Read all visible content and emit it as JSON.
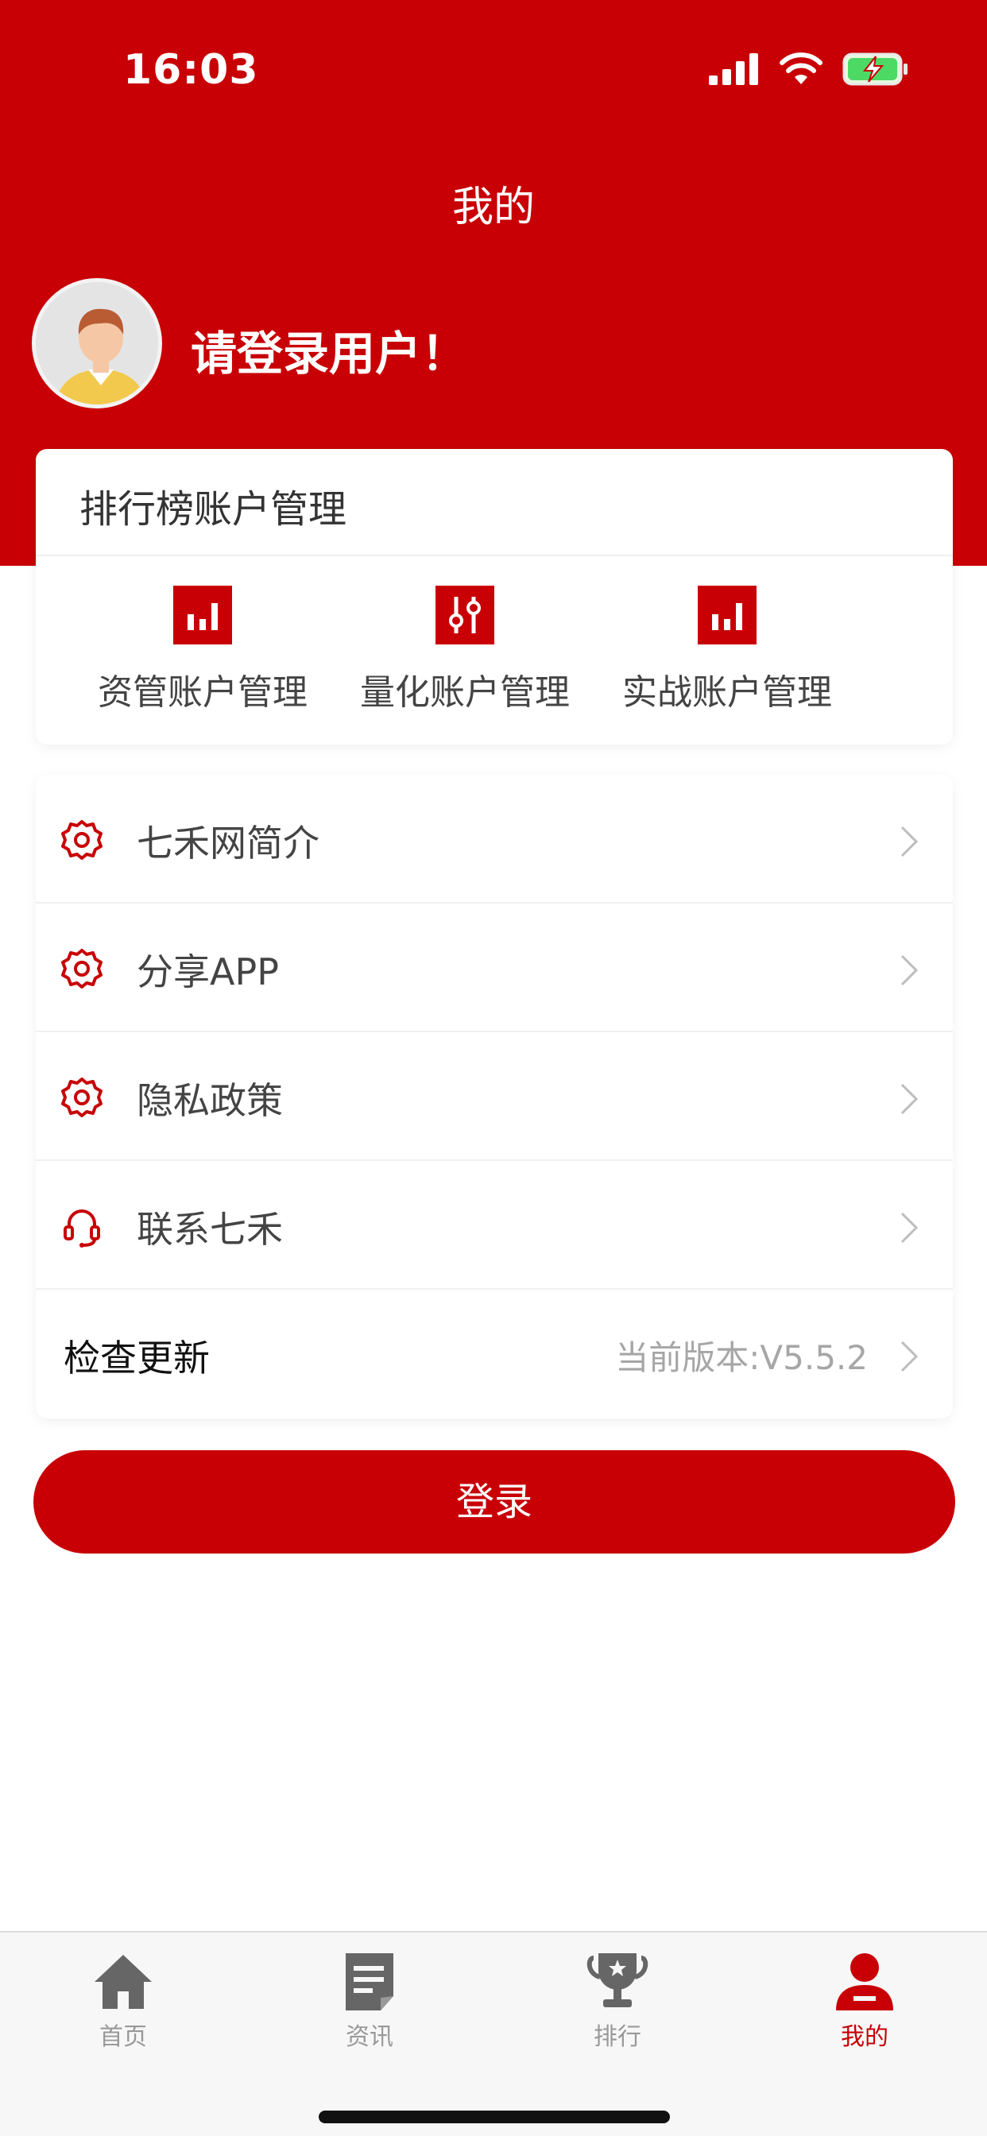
{
  "status_bar": {
    "time": "16:03"
  },
  "header": {
    "title": "我的"
  },
  "profile": {
    "login_prompt": "请登录用户！"
  },
  "ranking": {
    "title": "排行榜账户管理",
    "items": [
      {
        "label": "资管账户管理",
        "icon": "bar-chart-icon"
      },
      {
        "label": "量化账户管理",
        "icon": "sliders-icon"
      },
      {
        "label": "实战账户管理",
        "icon": "bar-chart-icon"
      }
    ]
  },
  "menu": {
    "items": [
      {
        "label": "七禾网简介",
        "icon": "gear-icon"
      },
      {
        "label": "分享APP",
        "icon": "gear-icon"
      },
      {
        "label": "隐私政策",
        "icon": "gear-icon"
      },
      {
        "label": "联系七禾",
        "icon": "headset-icon"
      }
    ],
    "update": {
      "label": "检查更新",
      "value": "当前版本:V5.5.2"
    }
  },
  "login_button": {
    "label": "登录"
  },
  "tab_bar": {
    "tabs": [
      {
        "label": "首页",
        "icon": "home-icon"
      },
      {
        "label": "资讯",
        "icon": "document-icon"
      },
      {
        "label": "排行",
        "icon": "trophy-icon"
      },
      {
        "label": "我的",
        "icon": "user-icon",
        "active": true
      }
    ]
  },
  "colors": {
    "brand": "#c80005",
    "tab_inactive": "#999999"
  }
}
